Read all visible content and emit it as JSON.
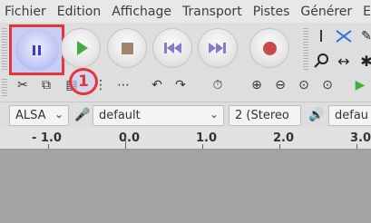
{
  "menu": [
    "Fichier",
    "Edition",
    "Affichage",
    "Transport",
    "Pistes",
    "Générer",
    "E"
  ],
  "transport": {
    "pause_icon": "pause-icon",
    "play_icon": "play-icon",
    "stop_icon": "stop-icon",
    "skip_start_icon": "skip-start-icon",
    "skip_end_icon": "skip-end-icon",
    "record_icon": "record-icon"
  },
  "annotation": {
    "badge_number": "1"
  },
  "device": {
    "host": "ALSA",
    "recording_device": "default",
    "channels": "2 (Stereo",
    "playback_device": "defau"
  },
  "ruler": {
    "labels": [
      "- 1.0",
      "0.0",
      "1.0",
      "2.0",
      "3.0"
    ]
  },
  "colors": {
    "highlight": "#e8323c",
    "pause_bg": "#c8cdf3"
  }
}
